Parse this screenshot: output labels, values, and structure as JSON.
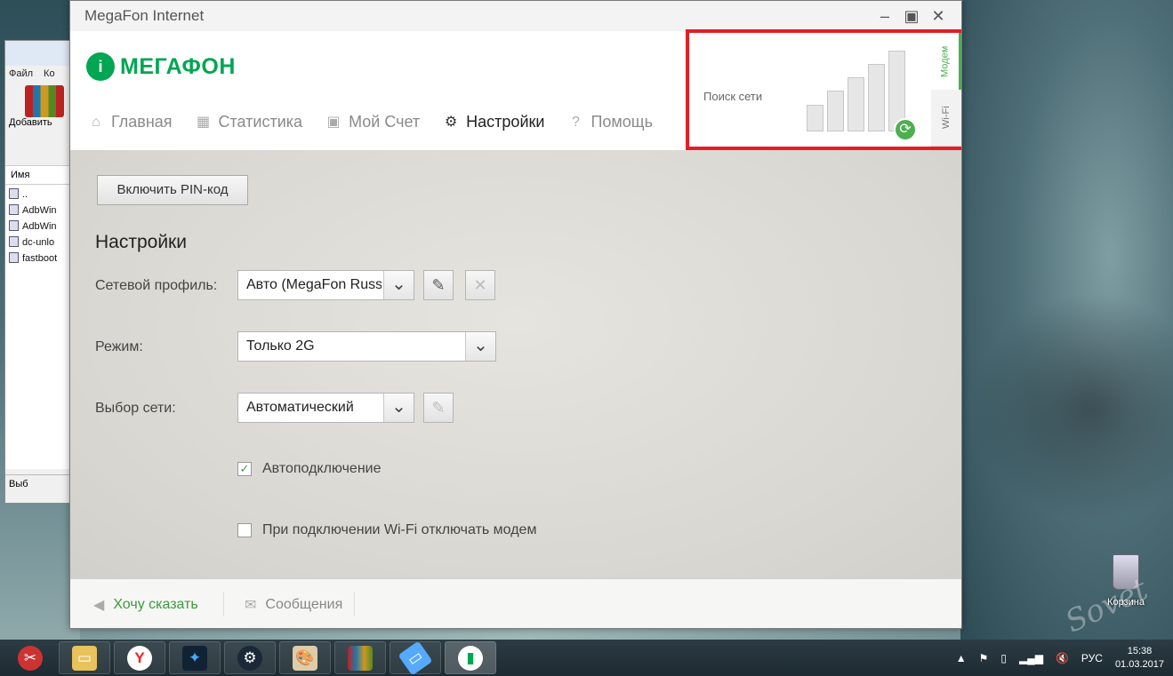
{
  "window": {
    "title": "MegaFon Internet",
    "controls": {
      "minimize": "–",
      "restore": "▣",
      "close": "✕"
    }
  },
  "brand": {
    "logo_mark": "i",
    "logo_text": "МЕГАФОН",
    "color": "#00a651"
  },
  "nav": {
    "items": [
      {
        "label": "Главная",
        "icon": "home-icon",
        "glyph": "⌂",
        "active": false
      },
      {
        "label": "Статистика",
        "icon": "statistics-icon",
        "glyph": "▦",
        "active": false
      },
      {
        "label": "Мой Счет",
        "icon": "wallet-icon",
        "glyph": "▣",
        "active": false
      },
      {
        "label": "Настройки",
        "icon": "gear-icon",
        "glyph": "⚙",
        "active": true
      },
      {
        "label": "Помощь",
        "icon": "help-icon",
        "glyph": "?",
        "active": false
      }
    ]
  },
  "status": {
    "label": "Поиск сети",
    "signal_bars_total": 5,
    "highlight_color": "#e31e24",
    "side_tabs": [
      {
        "label": "Модем",
        "active": true
      },
      {
        "label": "Wi-Fi",
        "active": false
      }
    ]
  },
  "settings": {
    "pin_button": "Включить PIN-код",
    "title": "Настройки",
    "network_profile": {
      "label": "Сетевой профиль:",
      "value": "Авто (MegaFon Russia)"
    },
    "mode": {
      "label": "Режим:",
      "value": "Только 2G"
    },
    "network_selection": {
      "label": "Выбор сети:",
      "value": "Автоматический"
    },
    "autoconnect": {
      "label": "Автоподключение",
      "checked": true
    },
    "disable_modem_on_wifi": {
      "label": "При подключении Wi-Fi отключать модем",
      "checked": false
    }
  },
  "footer": {
    "feedback": "Хочу сказать",
    "messages": "Сообщения",
    "accent": "#3a9a3a"
  },
  "background_window": {
    "menu": [
      "Файл",
      "Ко"
    ],
    "tool_label": "Добавить",
    "column_header": "Имя",
    "files": [
      "..",
      "AdbWin",
      "AdbWin",
      "dc-unlo",
      "fastboot"
    ],
    "status_text": "Выб"
  },
  "desktop": {
    "trash_label": "Корзина",
    "watermark": "Sovet"
  },
  "taskbar": {
    "language": "РУС",
    "time": "15:38",
    "date": "01.03.2017"
  }
}
